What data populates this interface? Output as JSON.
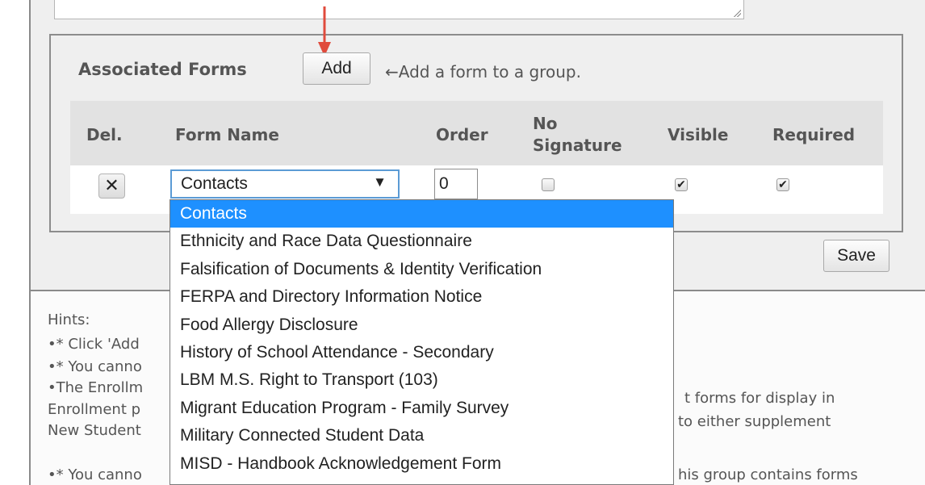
{
  "assoc": {
    "title": "Associated Forms",
    "add_label": "Add",
    "hint": "←Add a form to a group."
  },
  "columns": {
    "del": "Del.",
    "form_name": "Form Name",
    "order": "Order",
    "no_signature_1": "No",
    "no_signature_2": "Signature",
    "visible": "Visible",
    "required": "Required"
  },
  "row": {
    "del_glyph": "✕",
    "form_name": "Contacts",
    "select_arrow": "▼",
    "order": "0",
    "no_signature": "",
    "visible": "✔",
    "required": "✔"
  },
  "save_label": "Save",
  "hints": {
    "title": "Hints:",
    "line1": "•* Click 'Add",
    "line2": "•* You canno",
    "line3a": "•The Enrollm",
    "line3b": "t forms for display in",
    "line4a": "Enrollment p",
    "line4b": "to either supplement",
    "line5": "New Student",
    "line6a": "•* You canno",
    "line6b": "his group contains forms"
  },
  "dropdown": {
    "options": [
      "Contacts",
      "Ethnicity and Race Data Questionnaire",
      "Falsification of Documents & Identity Verification",
      "FERPA and Directory Information Notice",
      "Food Allergy Disclosure",
      "History of School Attendance - Secondary",
      "LBM M.S. Right to Transport (103)",
      "Migrant Education Program - Family Survey",
      "Military Connected Student Data",
      "MISD - Handbook Acknowledgement Form"
    ]
  },
  "colors": {
    "selection": "#1e90ff",
    "annotation_arrow": "#e04b3c"
  },
  "icons": {
    "annotation_arrow": "down-arrow-icon",
    "delete": "close-icon",
    "select": "chevron-down-icon",
    "checkbox_checked": "check-icon"
  }
}
